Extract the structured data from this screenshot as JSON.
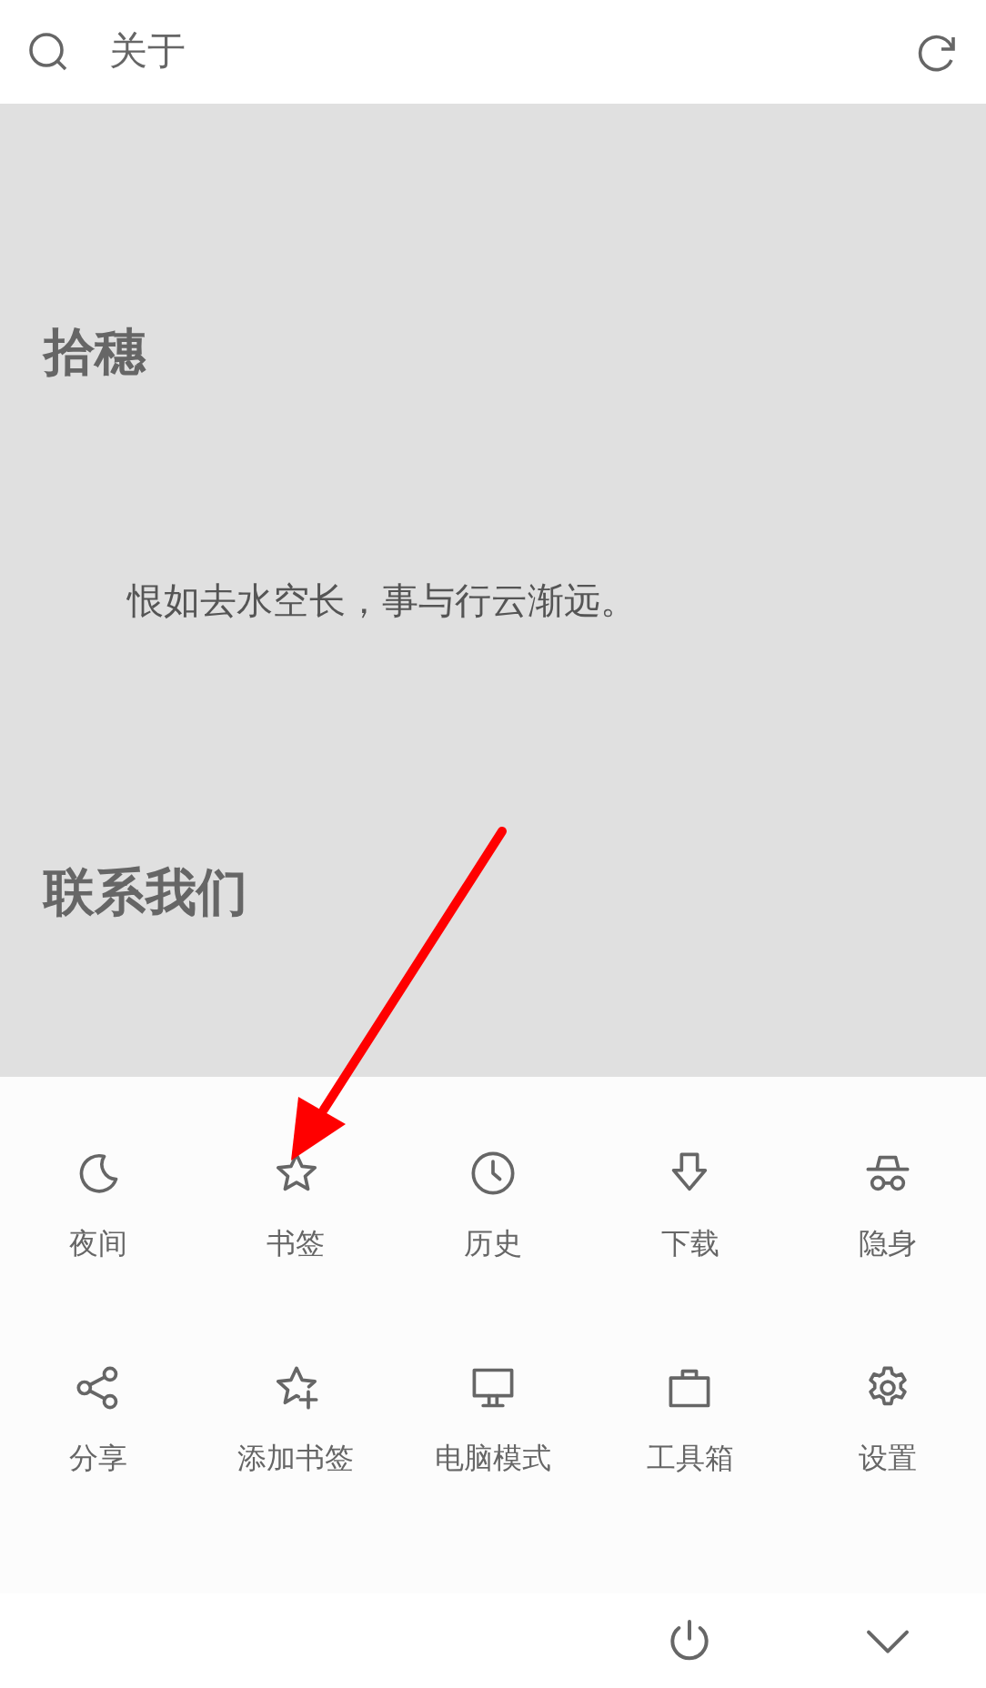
{
  "search_bar": {
    "value": "关于"
  },
  "content": {
    "title": "拾穗",
    "quote": "恨如去水空长，事与行云渐远。",
    "contact_heading": "联系我们"
  },
  "menu": {
    "items": [
      {
        "label": "夜间"
      },
      {
        "label": "书签"
      },
      {
        "label": "历史"
      },
      {
        "label": "下载"
      },
      {
        "label": "隐身"
      },
      {
        "label": "分享"
      },
      {
        "label": "添加书签"
      },
      {
        "label": "电脑模式"
      },
      {
        "label": "工具箱"
      },
      {
        "label": "设置"
      }
    ]
  }
}
